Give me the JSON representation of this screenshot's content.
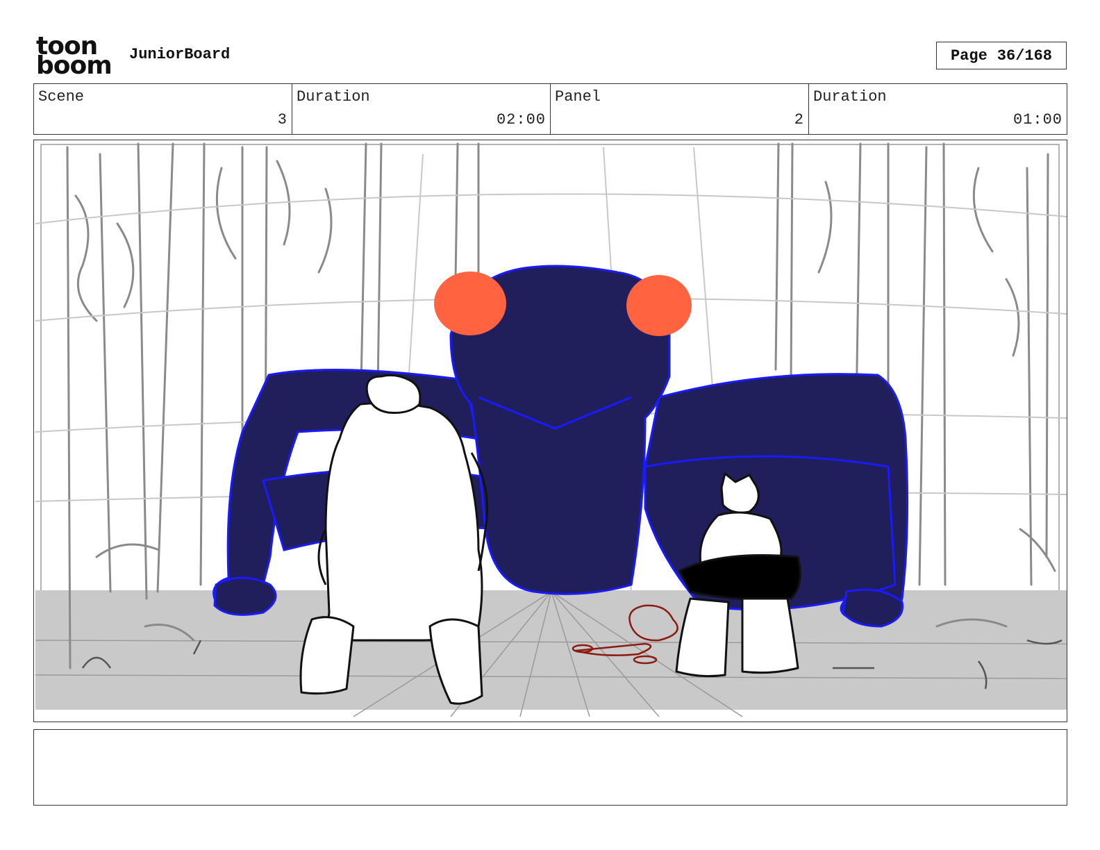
{
  "header": {
    "logo": {
      "line1": "toon",
      "line2": "boom"
    },
    "app_title": "JuniorBoard",
    "page_label": "Page",
    "page_value": "36/168"
  },
  "info": {
    "scene_label": "Scene",
    "scene_value": "3",
    "scene_duration_label": "Duration",
    "scene_duration_value": "02:00",
    "panel_label": "Panel",
    "panel_value": "2",
    "panel_duration_label": "Duration",
    "panel_duration_value": "01:00"
  },
  "notes": {
    "text": ""
  },
  "colors": {
    "creature": "#201f5c",
    "creature_outline": "#1a1aff",
    "eyes": "#ff6340",
    "ground": "#c9c9c9",
    "sketch": "#8a8a8a",
    "blood": "#8b1a10"
  }
}
